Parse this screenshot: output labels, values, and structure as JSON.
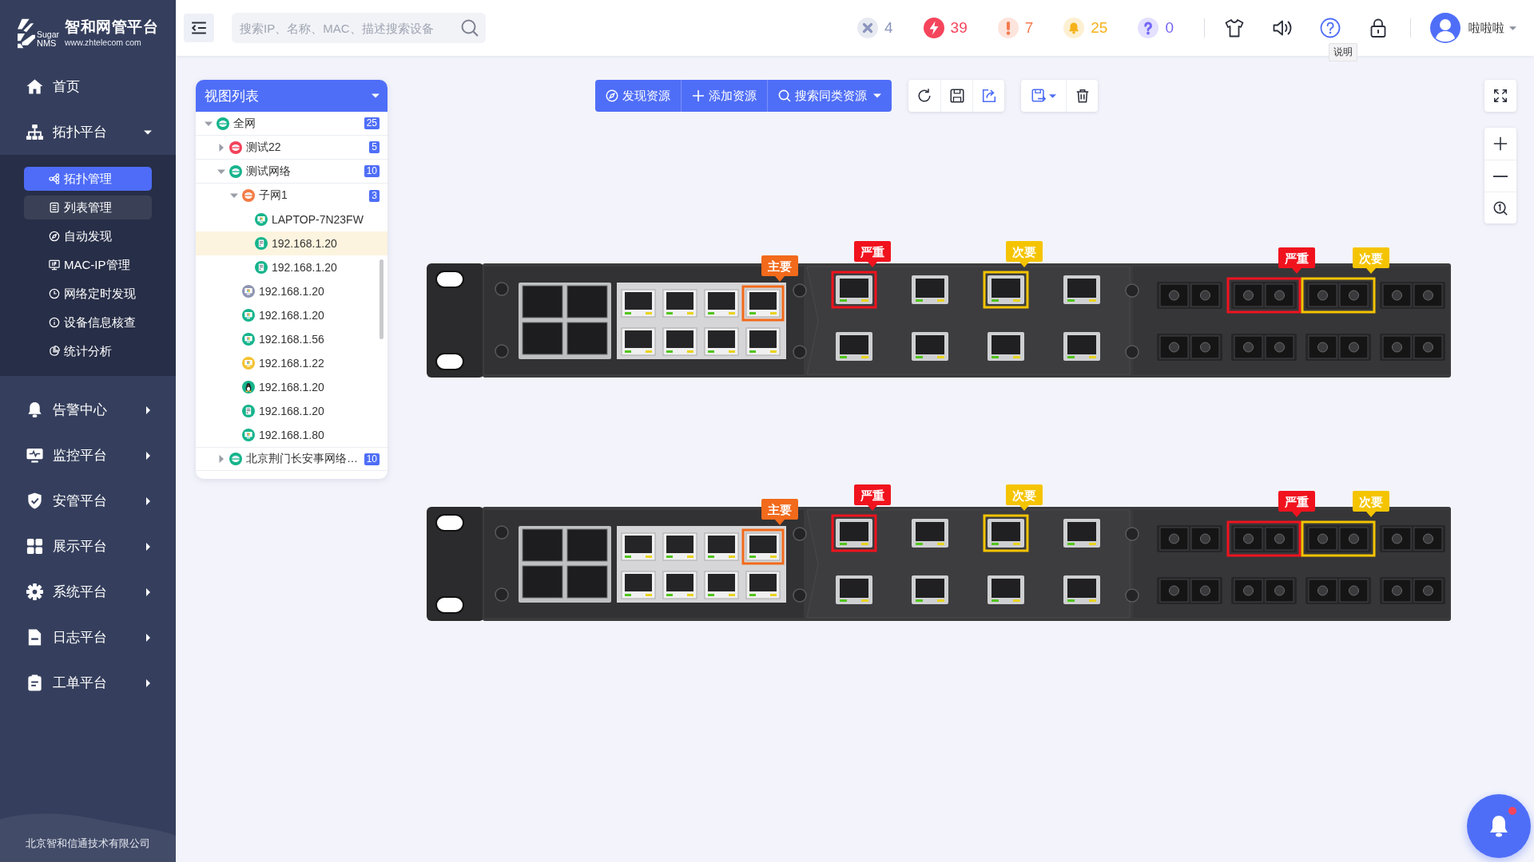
{
  "sidebar": {
    "logo": {
      "mark_lines": [
        "Sugar",
        "NMS"
      ],
      "title": "智和网管平台",
      "subtitle": "www.zhtelecom com"
    },
    "menu": [
      {
        "label": "首页",
        "kind": "link"
      },
      {
        "label": "拓扑平台",
        "kind": "group",
        "expanded": true,
        "children": [
          {
            "label": "拓扑管理",
            "selected": true,
            "hovered": false
          },
          {
            "label": "列表管理",
            "selected": false,
            "hovered": true
          },
          {
            "label": "自动发现",
            "selected": false,
            "hovered": false
          },
          {
            "label": "MAC-IP管理",
            "selected": false,
            "hovered": false
          },
          {
            "label": "网络定时发现",
            "selected": false,
            "hovered": false
          },
          {
            "label": "设备信息核查",
            "selected": false,
            "hovered": false
          },
          {
            "label": "统计分析",
            "selected": false,
            "hovered": false
          }
        ]
      },
      {
        "label": "告警中心",
        "kind": "group",
        "expanded": false
      },
      {
        "label": "监控平台",
        "kind": "group",
        "expanded": false
      },
      {
        "label": "安管平台",
        "kind": "group",
        "expanded": false
      },
      {
        "label": "展示平台",
        "kind": "group",
        "expanded": false
      },
      {
        "label": "系统平台",
        "kind": "group",
        "expanded": false
      },
      {
        "label": "日志平台",
        "kind": "group",
        "expanded": false
      },
      {
        "label": "工单平台",
        "kind": "group",
        "expanded": false
      }
    ],
    "footer": "北京智和信通技术有限公司"
  },
  "topbar": {
    "search": {
      "placeholder": "搜索IP、名称、MAC、描述搜索设备"
    },
    "alarm_counters": [
      {
        "count": "4",
        "color": "#8c95bd"
      },
      {
        "count": "39",
        "color": "#f5455c"
      },
      {
        "count": "7",
        "color": "#f57a4f"
      },
      {
        "count": "25",
        "color": "#f5b21c"
      },
      {
        "count": "0",
        "color": "#7467f4"
      }
    ],
    "help_tooltip": "说明",
    "user": {
      "name": "啦啦啦"
    }
  },
  "toolbar": {
    "actions": [
      {
        "label": "发现资源",
        "dropdown": false
      },
      {
        "label": "添加资源",
        "dropdown": false
      },
      {
        "label": "搜索同类资源",
        "dropdown": true
      }
    ]
  },
  "view_panel": {
    "title": "视图列表",
    "nodes": [
      {
        "label": "全网",
        "kind": "network",
        "color": "#16b48c",
        "count": "25",
        "expanded": true,
        "selected": false,
        "children": [
          {
            "label": "测试22",
            "kind": "network",
            "color": "#f3415a",
            "count": "5",
            "expanded": false,
            "selected": false
          },
          {
            "label": "测试网络",
            "kind": "network",
            "color": "#16b48c",
            "count": "10",
            "expanded": true,
            "selected": false,
            "children": [
              {
                "label": "子网1",
                "kind": "network",
                "color": "#f47b45",
                "count": "3",
                "expanded": true,
                "selected": false,
                "children": [
                  {
                    "label": "LAPTOP-7N23FW",
                    "kind": "pc",
                    "color": "#16b48c",
                    "selected": false
                  },
                  {
                    "label": "192.168.1.20",
                    "kind": "server",
                    "color": "#16b48c",
                    "selected": true
                  },
                  {
                    "label": "192.168.1.20",
                    "kind": "server",
                    "color": "#16b48c",
                    "selected": false
                  }
                ]
              },
              {
                "label": "192.168.1.20",
                "kind": "pc",
                "color": "#8f95b3",
                "selected": false
              },
              {
                "label": "192.168.1.20",
                "kind": "pc",
                "color": "#16b48c",
                "selected": false
              },
              {
                "label": "192.168.1.56",
                "kind": "pc",
                "color": "#16b48c",
                "selected": false
              },
              {
                "label": "192.168.1.22",
                "kind": "pc",
                "color": "#f5c230",
                "selected": false
              },
              {
                "label": "192.168.1.20",
                "kind": "linux",
                "color": "#16b48c",
                "selected": false
              },
              {
                "label": "192.168.1.20",
                "kind": "server",
                "color": "#16b48c",
                "selected": false
              },
              {
                "label": "192.168.1.80",
                "kind": "pc",
                "color": "#16b48c",
                "selected": false
              }
            ]
          },
          {
            "label": "北京荆门长安事网络…",
            "kind": "network",
            "color": "#16b48c",
            "count": "10",
            "expanded": false,
            "selected": false
          }
        ]
      }
    ]
  },
  "devices": [
    {
      "panels": [
        {
          "kind": "combo",
          "ports": [
            {
              "alarmed": false
            },
            {
              "alarmed": false
            },
            {
              "alarmed": false
            },
            {
              "alarmed": true,
              "label": "主要",
              "color": "#f26a1b"
            },
            {
              "alarmed": false
            },
            {
              "alarmed": false
            },
            {
              "alarmed": false
            },
            {
              "alarmed": false
            }
          ]
        },
        {
          "kind": "copper",
          "ports": [
            {
              "alarmed": true,
              "label": "严重",
              "color": "#f0131e"
            },
            {
              "alarmed": false
            },
            {
              "alarmed": true,
              "label": "次要",
              "color": "#f5c400"
            },
            {
              "alarmed": false
            },
            {
              "alarmed": false
            },
            {
              "alarmed": false
            },
            {
              "alarmed": false
            },
            {
              "alarmed": false
            }
          ]
        },
        {
          "kind": "fiber",
          "ports": [
            {
              "alarmed": false
            },
            {
              "alarmed": true,
              "label": "严重",
              "color": "#f0131e"
            },
            {
              "alarmed": true,
              "label": "次要",
              "color": "#f5c400"
            },
            {
              "alarmed": false
            },
            {
              "alarmed": false
            },
            {
              "alarmed": false
            },
            {
              "alarmed": false
            },
            {
              "alarmed": false
            }
          ]
        }
      ]
    },
    {
      "panels": [
        {
          "kind": "combo",
          "ports": [
            {
              "alarmed": false
            },
            {
              "alarmed": false
            },
            {
              "alarmed": false
            },
            {
              "alarmed": true,
              "label": "主要",
              "color": "#f26a1b"
            },
            {
              "alarmed": false
            },
            {
              "alarmed": false
            },
            {
              "alarmed": false
            },
            {
              "alarmed": false
            }
          ]
        },
        {
          "kind": "copper",
          "ports": [
            {
              "alarmed": true,
              "label": "严重",
              "color": "#f0131e"
            },
            {
              "alarmed": false
            },
            {
              "alarmed": true,
              "label": "次要",
              "color": "#f5c400"
            },
            {
              "alarmed": false
            },
            {
              "alarmed": false
            },
            {
              "alarmed": false
            },
            {
              "alarmed": false
            },
            {
              "alarmed": false
            }
          ]
        },
        {
          "kind": "fiber",
          "ports": [
            {
              "alarmed": false
            },
            {
              "alarmed": true,
              "label": "严重",
              "color": "#f0131e"
            },
            {
              "alarmed": true,
              "label": "次要",
              "color": "#f5c400"
            },
            {
              "alarmed": false
            },
            {
              "alarmed": false
            },
            {
              "alarmed": false
            },
            {
              "alarmed": false
            },
            {
              "alarmed": false
            }
          ]
        }
      ]
    }
  ],
  "notification_button": {
    "unread": true
  }
}
